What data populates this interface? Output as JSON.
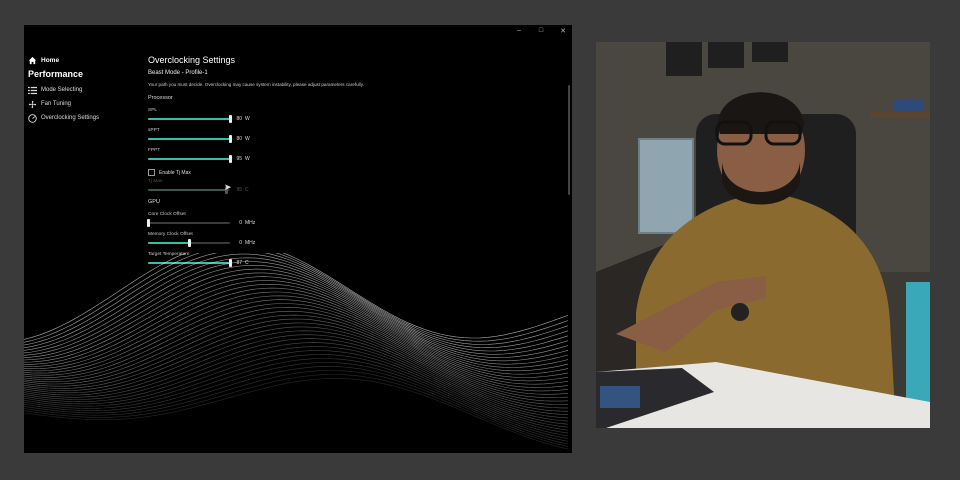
{
  "window": {
    "controls": [
      "–",
      "□",
      "✕"
    ]
  },
  "sidebar": {
    "home": "Home",
    "section": "Performance",
    "items": [
      {
        "label": "Mode Selecting",
        "icon": "list-icon"
      },
      {
        "label": "Fan Tuning",
        "icon": "fan-icon"
      },
      {
        "label": "Overclocking Settings",
        "icon": "overclock-icon"
      }
    ]
  },
  "main": {
    "title": "Overclocking Settings",
    "profile": "Beast Mode - Profile-1",
    "warning": "Your path you must decide.  Overclocking may cause system instability, please adjust parameters carefully.",
    "processor": {
      "heading": "Processor",
      "spl": {
        "label": "SPL",
        "value": "80",
        "unit": "W",
        "level": 1.0
      },
      "sppt": {
        "label": "sPPT",
        "value": "80",
        "unit": "W",
        "level": 1.0
      },
      "fppt": {
        "label": "FPPT",
        "value": "95",
        "unit": "W",
        "level": 1.0
      },
      "tj_checkbox": "Enable Tj Max",
      "tjmax": {
        "label": "Tj Max",
        "value": "95",
        "unit": "C",
        "level": 0.95
      }
    },
    "gpu": {
      "heading": "GPU",
      "core": {
        "label": "Core Clock Offset",
        "value": "0",
        "unit": "MHz",
        "level": 0.0
      },
      "memory": {
        "label": "Memory Clock Offset",
        "value": "0",
        "unit": "MHz",
        "level": 0.5
      },
      "temp": {
        "label": "Target Temperature",
        "value": "87",
        "unit": "C",
        "level": 1.0
      }
    }
  },
  "colors": {
    "accent": "#34c0a8",
    "background": "#000000",
    "frame": "#3a3a3a"
  }
}
